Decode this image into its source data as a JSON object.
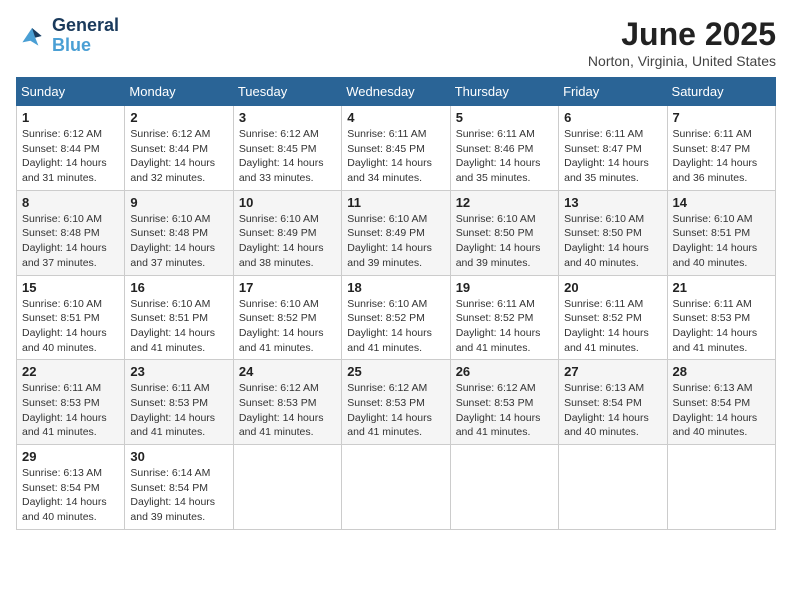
{
  "header": {
    "logo_line1": "General",
    "logo_line2": "Blue",
    "month_title": "June 2025",
    "location": "Norton, Virginia, United States"
  },
  "weekdays": [
    "Sunday",
    "Monday",
    "Tuesday",
    "Wednesday",
    "Thursday",
    "Friday",
    "Saturday"
  ],
  "weeks": [
    [
      {
        "day": "1",
        "info": "Sunrise: 6:12 AM\nSunset: 8:44 PM\nDaylight: 14 hours\nand 31 minutes."
      },
      {
        "day": "2",
        "info": "Sunrise: 6:12 AM\nSunset: 8:44 PM\nDaylight: 14 hours\nand 32 minutes."
      },
      {
        "day": "3",
        "info": "Sunrise: 6:12 AM\nSunset: 8:45 PM\nDaylight: 14 hours\nand 33 minutes."
      },
      {
        "day": "4",
        "info": "Sunrise: 6:11 AM\nSunset: 8:45 PM\nDaylight: 14 hours\nand 34 minutes."
      },
      {
        "day": "5",
        "info": "Sunrise: 6:11 AM\nSunset: 8:46 PM\nDaylight: 14 hours\nand 35 minutes."
      },
      {
        "day": "6",
        "info": "Sunrise: 6:11 AM\nSunset: 8:47 PM\nDaylight: 14 hours\nand 35 minutes."
      },
      {
        "day": "7",
        "info": "Sunrise: 6:11 AM\nSunset: 8:47 PM\nDaylight: 14 hours\nand 36 minutes."
      }
    ],
    [
      {
        "day": "8",
        "info": "Sunrise: 6:10 AM\nSunset: 8:48 PM\nDaylight: 14 hours\nand 37 minutes."
      },
      {
        "day": "9",
        "info": "Sunrise: 6:10 AM\nSunset: 8:48 PM\nDaylight: 14 hours\nand 37 minutes."
      },
      {
        "day": "10",
        "info": "Sunrise: 6:10 AM\nSunset: 8:49 PM\nDaylight: 14 hours\nand 38 minutes."
      },
      {
        "day": "11",
        "info": "Sunrise: 6:10 AM\nSunset: 8:49 PM\nDaylight: 14 hours\nand 39 minutes."
      },
      {
        "day": "12",
        "info": "Sunrise: 6:10 AM\nSunset: 8:50 PM\nDaylight: 14 hours\nand 39 minutes."
      },
      {
        "day": "13",
        "info": "Sunrise: 6:10 AM\nSunset: 8:50 PM\nDaylight: 14 hours\nand 40 minutes."
      },
      {
        "day": "14",
        "info": "Sunrise: 6:10 AM\nSunset: 8:51 PM\nDaylight: 14 hours\nand 40 minutes."
      }
    ],
    [
      {
        "day": "15",
        "info": "Sunrise: 6:10 AM\nSunset: 8:51 PM\nDaylight: 14 hours\nand 40 minutes."
      },
      {
        "day": "16",
        "info": "Sunrise: 6:10 AM\nSunset: 8:51 PM\nDaylight: 14 hours\nand 41 minutes."
      },
      {
        "day": "17",
        "info": "Sunrise: 6:10 AM\nSunset: 8:52 PM\nDaylight: 14 hours\nand 41 minutes."
      },
      {
        "day": "18",
        "info": "Sunrise: 6:10 AM\nSunset: 8:52 PM\nDaylight: 14 hours\nand 41 minutes."
      },
      {
        "day": "19",
        "info": "Sunrise: 6:11 AM\nSunset: 8:52 PM\nDaylight: 14 hours\nand 41 minutes."
      },
      {
        "day": "20",
        "info": "Sunrise: 6:11 AM\nSunset: 8:52 PM\nDaylight: 14 hours\nand 41 minutes."
      },
      {
        "day": "21",
        "info": "Sunrise: 6:11 AM\nSunset: 8:53 PM\nDaylight: 14 hours\nand 41 minutes."
      }
    ],
    [
      {
        "day": "22",
        "info": "Sunrise: 6:11 AM\nSunset: 8:53 PM\nDaylight: 14 hours\nand 41 minutes."
      },
      {
        "day": "23",
        "info": "Sunrise: 6:11 AM\nSunset: 8:53 PM\nDaylight: 14 hours\nand 41 minutes."
      },
      {
        "day": "24",
        "info": "Sunrise: 6:12 AM\nSunset: 8:53 PM\nDaylight: 14 hours\nand 41 minutes."
      },
      {
        "day": "25",
        "info": "Sunrise: 6:12 AM\nSunset: 8:53 PM\nDaylight: 14 hours\nand 41 minutes."
      },
      {
        "day": "26",
        "info": "Sunrise: 6:12 AM\nSunset: 8:53 PM\nDaylight: 14 hours\nand 41 minutes."
      },
      {
        "day": "27",
        "info": "Sunrise: 6:13 AM\nSunset: 8:54 PM\nDaylight: 14 hours\nand 40 minutes."
      },
      {
        "day": "28",
        "info": "Sunrise: 6:13 AM\nSunset: 8:54 PM\nDaylight: 14 hours\nand 40 minutes."
      }
    ],
    [
      {
        "day": "29",
        "info": "Sunrise: 6:13 AM\nSunset: 8:54 PM\nDaylight: 14 hours\nand 40 minutes."
      },
      {
        "day": "30",
        "info": "Sunrise: 6:14 AM\nSunset: 8:54 PM\nDaylight: 14 hours\nand 39 minutes."
      },
      null,
      null,
      null,
      null,
      null
    ]
  ]
}
